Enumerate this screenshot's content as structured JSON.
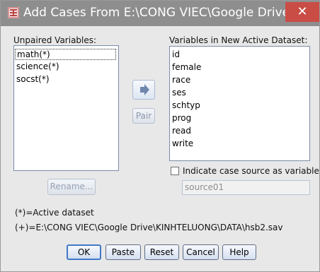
{
  "window": {
    "title": "Add Cases From E:\\CONG VIEC\\Google Drive...",
    "close_glyph": "✕"
  },
  "unpaired": {
    "label": "Unpaired Variables:",
    "items": [
      "math(*)",
      "science(*)",
      "socst(*)"
    ],
    "selected": "math(*)"
  },
  "transfer": {
    "arrow_icon": "right-arrow-icon",
    "pair_label": "Pair"
  },
  "new_dataset": {
    "label": "Variables in New Active Dataset:",
    "items": [
      "id",
      "female",
      "race",
      "ses",
      "schtyp",
      "prog",
      "read",
      "write"
    ]
  },
  "rename_label": "Rename...",
  "indicate_source": {
    "label": "Indicate case source as variable:",
    "checked": false,
    "value": "source01"
  },
  "legend": {
    "active": "(*)=Active dataset",
    "file": "(+)=E:\\CONG VIEC\\Google Drive\\KINHTELUONG\\DATA\\hsb2.sav"
  },
  "buttons": {
    "ok": "OK",
    "paste": "Paste",
    "reset": "Reset",
    "cancel": "Cancel",
    "help": "Help"
  },
  "colors": {
    "titlebar": "#8e8e8e",
    "close": "#c94d45",
    "arrow": "#6f86ad"
  }
}
